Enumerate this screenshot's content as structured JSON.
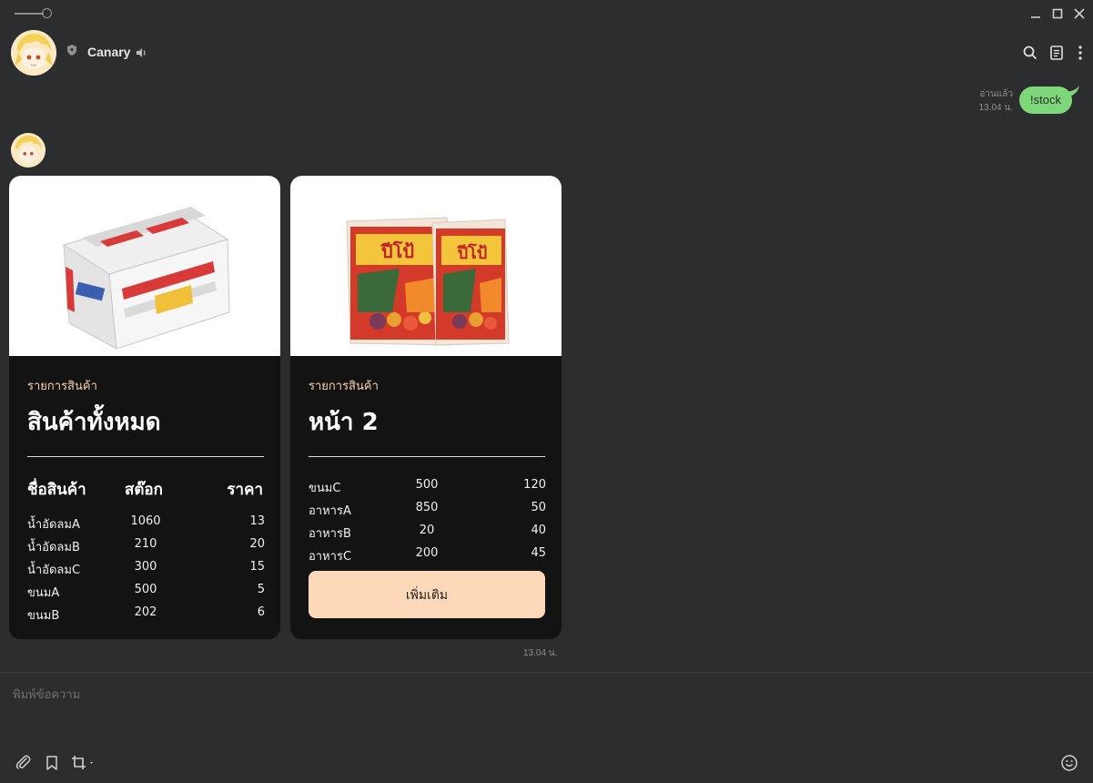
{
  "header": {
    "chat_name": "Canary"
  },
  "messages": {
    "outgoing": {
      "status": "อ่านแล้ว",
      "time": "13.04 น.",
      "text": "!stock"
    },
    "incoming_time": "13.04 น."
  },
  "cards": [
    {
      "subtitle": "รายการสินค้า",
      "title": "สินค้าทั้งหมด",
      "columns": [
        "ชื่อสินค้า",
        "สต๊อก",
        "ราคา"
      ],
      "rows": [
        {
          "name": "น้ำอัดลมA",
          "stock": "1060",
          "price": "13"
        },
        {
          "name": "น้ำอัดลมB",
          "stock": "210",
          "price": "20"
        },
        {
          "name": "น้ำอัดลมC",
          "stock": "300",
          "price": "15"
        },
        {
          "name": "ขนมA",
          "stock": "500",
          "price": "5"
        },
        {
          "name": "ขนมB",
          "stock": "202",
          "price": "6"
        }
      ]
    },
    {
      "subtitle": "รายการสินค้า",
      "title": "หน้า 2",
      "rows": [
        {
          "name": "ขนมC",
          "stock": "500",
          "price": "120"
        },
        {
          "name": "อาหารA",
          "stock": "850",
          "price": "50"
        },
        {
          "name": "อาหารB",
          "stock": "20",
          "price": "40"
        },
        {
          "name": "อาหารC",
          "stock": "200",
          "price": "45"
        }
      ],
      "button_label": "เพิ่มเติม"
    }
  ],
  "composer": {
    "placeholder": "พิมพ์ข้อความ"
  },
  "colors": {
    "background": "#2c2d2f",
    "bubble_out": "#7ed87a",
    "card_bg": "#131313",
    "accent_button": "#fdd9b9",
    "subtitle": "#f7d2b0"
  }
}
